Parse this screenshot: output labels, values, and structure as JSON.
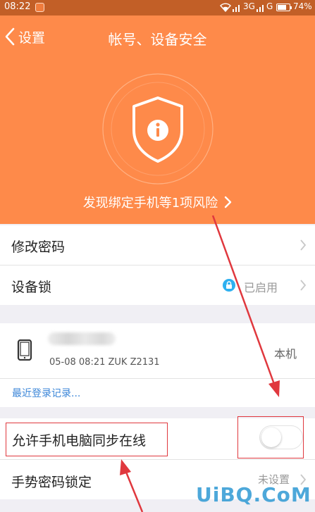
{
  "status_bar": {
    "time": "08:22",
    "network": "3G",
    "network2": "G",
    "battery_level": 0.74,
    "battery_text": "74%"
  },
  "header": {
    "back_label": "设置",
    "title": "帐号、设备安全",
    "risk_text": "发现绑定手机等1项风险"
  },
  "settings": {
    "change_password": "修改密码",
    "device_lock": "设备锁",
    "device_lock_status": "已启用"
  },
  "device": {
    "info": "05-08 08:21 ZUK Z2131",
    "this_device": "本机",
    "recent_login_link": "最近登录记录..."
  },
  "sync": {
    "label": "允许手机电脑同步在线",
    "enabled": false
  },
  "gesture": {
    "label": "手势密码锁定",
    "status": "未设置"
  },
  "watermark": {
    "text": "UiBQ.CoM"
  },
  "colors": {
    "header_bg": "#fe8a4a",
    "status_bg": "#c25f27",
    "link_blue": "#3b86d8",
    "annotation_red": "#e0383e",
    "lock_icon_bg": "#2db0f0"
  }
}
